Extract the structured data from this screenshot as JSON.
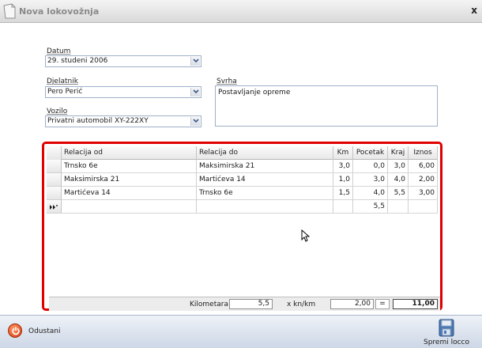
{
  "window": {
    "title": "Nova lokovožnja",
    "close_label": "x"
  },
  "form": {
    "datum": {
      "label": "Datum",
      "value": "29. studeni 2006"
    },
    "djelatnik": {
      "label": "Djelatnik",
      "value": "Pero Perić"
    },
    "vozilo": {
      "label": "Vozilo",
      "value": "Privatni automobil XY-222XY"
    },
    "svrha": {
      "label": "Svrha",
      "value": "Postavljanje  opreme"
    }
  },
  "grid": {
    "headers": {
      "relacija_od": "Relacija od",
      "relacija_do": "Relacija do",
      "km": "Km",
      "pocetak": "Pocetak",
      "kraj": "Kraj",
      "iznos": "Iznos"
    },
    "rows": [
      {
        "relacija_od": "Trnsko 6e",
        "relacija_do": "Maksimirska 21",
        "km": "3,0",
        "pocetak": "0,0",
        "kraj": "3,0",
        "iznos": "6,00"
      },
      {
        "relacija_od": "Maksimirska 21",
        "relacija_do": "Martićeva 14",
        "km": "1,0",
        "pocetak": "3,0",
        "kraj": "4,0",
        "iznos": "2,00"
      },
      {
        "relacija_od": "Martićeva 14",
        "relacija_do": "Trnsko 6e",
        "km": "1,5",
        "pocetak": "4,0",
        "kraj": "5,5",
        "iznos": "3,00"
      }
    ],
    "new_row": {
      "pocetak": "5,5"
    }
  },
  "totals": {
    "kilometara_label": "Kilometara",
    "kilometara_value": "5,5",
    "rate_label": "x kn/km",
    "rate_value": "2,00",
    "equals": "=",
    "total": "11,00"
  },
  "buttons": {
    "cancel": "Odustani",
    "save": "Spremi locco"
  },
  "colors": {
    "highlight": "#e00000",
    "accent": "#3a6ea5"
  }
}
